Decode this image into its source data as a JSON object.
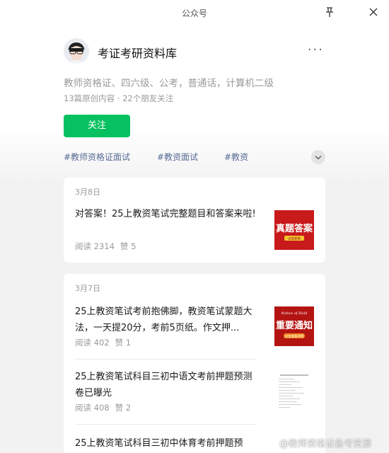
{
  "window": {
    "title": "公众号"
  },
  "profile": {
    "name": "考证考研资料库",
    "description": "教师资格证、四六级、公考，普通话，计算机二级",
    "stats": "13篇原创内容 · 22个朋友关注",
    "follow_label": "关注",
    "more_label": "···"
  },
  "tags": [
    "#教师资格证面试",
    "#教资面试",
    "#教资"
  ],
  "groups": [
    {
      "date": "3月8日",
      "articles": [
        {
          "title": "对答案！25上教资笔试完整题目和答案来啦!",
          "reads": "阅读 2314",
          "likes": "赞 5",
          "thumb_text": "真题答案",
          "thumb_sub": "点击获取"
        }
      ]
    },
    {
      "date": "3月7日",
      "articles": [
        {
          "title": "25上教资笔试考前抱佛脚，教资笔试蒙题大法，一天提20分，考前5页纸。作文押...",
          "reads": "阅读 402",
          "likes": "赞 1",
          "thumb_text": "重要通知",
          "thumb_sub": "点击查看详情",
          "thumb_top": "Notice of Hold"
        },
        {
          "title": "25上教资笔试科目三初中语文考前押题预测卷已曝光",
          "reads": "阅读 408",
          "likes": "赞 2"
        },
        {
          "title": "25上教资笔试科目三初中体育考前押题预"
        }
      ]
    }
  ],
  "watermark": "@教师资格证备考资源",
  "colors": {
    "accent": "#07c160",
    "tag": "#576b95",
    "thumb_red": "#c8191b"
  }
}
